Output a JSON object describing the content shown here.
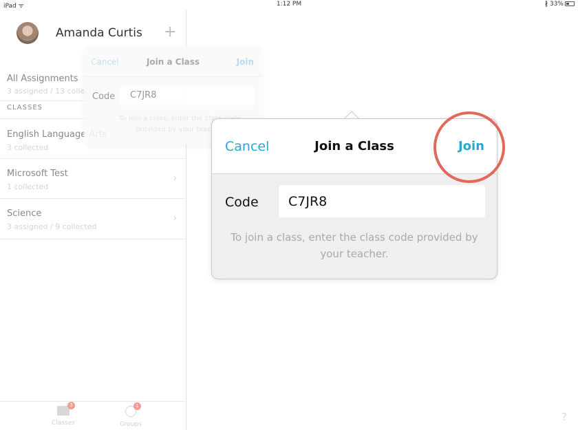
{
  "status_bar": {
    "device": "iPad",
    "time": "1:12 PM",
    "battery": "33%"
  },
  "sidebar": {
    "user_name": "Amanda Curtis",
    "all_assignments": {
      "title": "All Assignments",
      "subtitle": "3 assigned / 13 collected"
    },
    "section_label": "CLASSES",
    "classes": [
      {
        "title": "English Language Arts",
        "subtitle": "3 collected"
      },
      {
        "title": "Microsoft Test",
        "subtitle": "1 collected"
      },
      {
        "title": "Science",
        "subtitle": "3 assigned / 9 collected"
      }
    ],
    "tabs": [
      {
        "label": "Classes",
        "badge": "3"
      },
      {
        "label": "Groups",
        "badge": "1"
      }
    ]
  },
  "mini_popover": {
    "cancel": "Cancel",
    "title": "Join a Class",
    "join": "Join",
    "code_label": "Code",
    "code_value": "C7JR8",
    "help": "To join a class, enter the class code provided by your teacher."
  },
  "popover": {
    "cancel": "Cancel",
    "title": "Join a Class",
    "join": "Join",
    "code_label": "Code",
    "code_value": "C7JR8",
    "help": "To join a class, enter the class code provided by your teacher."
  },
  "help_mark": "?",
  "colors": {
    "accent": "#2aa6d3",
    "highlight": "#e2685a",
    "badge": "#f29a96"
  }
}
